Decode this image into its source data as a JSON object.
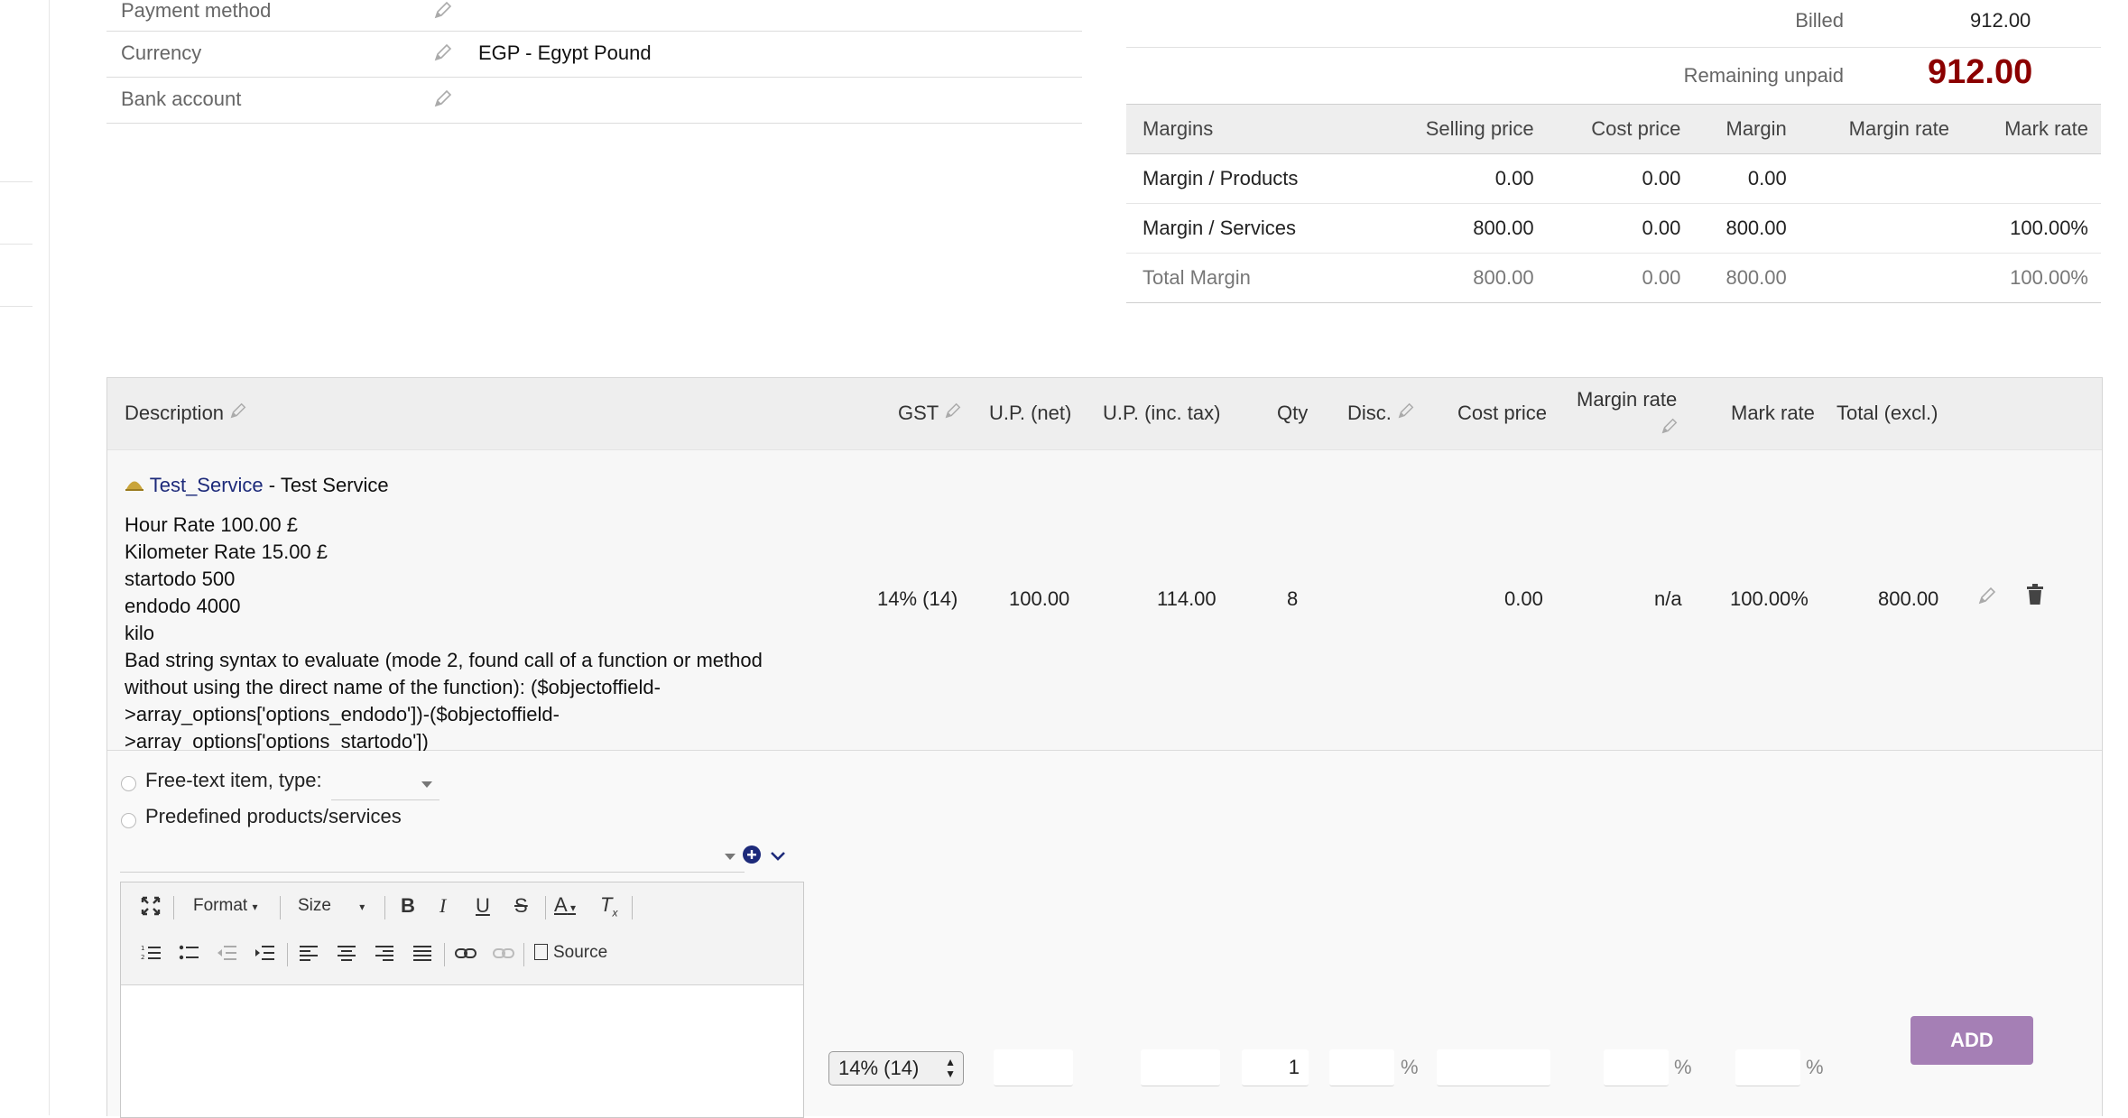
{
  "fields": [
    {
      "label": "Payment method",
      "value": ""
    },
    {
      "label": "Currency",
      "value": "EGP - Egypt Pound"
    },
    {
      "label": "Bank account",
      "value": ""
    }
  ],
  "billed": {
    "label": "Billed",
    "value": "912.00"
  },
  "remaining": {
    "label": "Remaining unpaid",
    "value": "912.00",
    "color": "#8b0000"
  },
  "margins": {
    "headers": [
      "Margins",
      "Selling price",
      "Cost price",
      "Margin",
      "Margin rate",
      "Mark rate"
    ],
    "rows": [
      {
        "name": "Margin / Products",
        "selling": "0.00",
        "cost": "0.00",
        "margin": "0.00",
        "margin_rate": "",
        "mark_rate": ""
      },
      {
        "name": "Margin / Services",
        "selling": "800.00",
        "cost": "0.00",
        "margin": "800.00",
        "margin_rate": "",
        "mark_rate": "100.00%"
      },
      {
        "name": "Total Margin",
        "selling": "800.00",
        "cost": "0.00",
        "margin": "800.00",
        "margin_rate": "",
        "mark_rate": "100.00%"
      }
    ]
  },
  "lines": {
    "headers": {
      "description": "Description",
      "gst": "GST",
      "up_net": "U.P. (net)",
      "up_inc": "U.P. (inc. tax)",
      "qty": "Qty",
      "disc": "Disc.",
      "cost_price": "Cost price",
      "margin_rate": "Margin rate",
      "mark_rate": "Mark rate",
      "total": "Total (excl.)"
    },
    "row": {
      "ref": "Test_Service",
      "label": " - Test Service",
      "desc_lines": [
        "Hour Rate 100.00 £",
        "Kilometer Rate 15.00 £",
        "startodo 500",
        "endodo 4000",
        "kilo",
        "Bad string syntax to evaluate (mode 2, found call of a function or method",
        "without using the direct name of the function): ($objectoffield-",
        ">array_options['options_endodo'])-($objectoffield-",
        ">array_options['options_startodo'])"
      ],
      "gst": "14% (14)",
      "up_net": "100.00",
      "up_inc": "114.00",
      "qty": "8",
      "cost_price": "0.00",
      "margin_rate": "n/a",
      "mark_rate": "100.00%",
      "total": "800.00"
    }
  },
  "add_form": {
    "free_text_label": "Free-text item, type:",
    "predefined_label": "Predefined products/services",
    "toolbar": {
      "format": "Format",
      "size": "Size",
      "source": "Source"
    },
    "gst_value": "14% (14)",
    "qty_value": "1",
    "percent_sign": "%",
    "add_label": "ADD"
  },
  "colors": {
    "accent": "#a57fb5",
    "link": "#1d2a7a",
    "remaining": "#8b0000"
  }
}
